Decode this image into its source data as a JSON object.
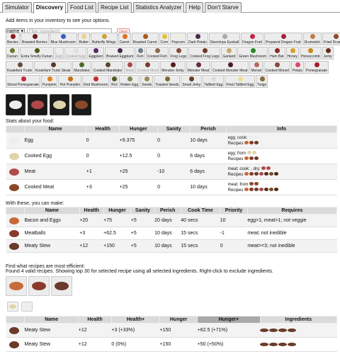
{
  "tabs": [
    "Simulator",
    "Discovery",
    "Food List",
    "Recipe List",
    "Statistics Analyzer",
    "Help",
    "Don't Starve"
  ],
  "active_tab": "Discovery",
  "intro": "Add items in your inventory to see your options.",
  "filter": {
    "select_value": "name ▾",
    "placeholder": "Filter ingredients",
    "clear_label": "clear"
  },
  "ingredient_rows": [
    [
      {
        "n": "Berries",
        "c": "#8b1a1a"
      },
      {
        "n": "Roasted Berries",
        "c": "#6b1a1a"
      },
      {
        "n": "Blue Mushroom",
        "c": "#3a5ec8"
      },
      {
        "n": "Butter",
        "c": "#e8d28a"
      },
      {
        "n": "Butterfly Wings",
        "c": "#c9a43a"
      },
      {
        "n": "Carrot",
        "c": "#e0701a"
      },
      {
        "n": "Roasted Carrot",
        "c": "#a85a20"
      },
      {
        "n": "Corn",
        "c": "#e4c23a"
      },
      {
        "n": "Popcorn",
        "c": "#eeeedd"
      },
      {
        "n": "Dark Petals",
        "c": "#4a2a4a"
      },
      {
        "n": "Deerclops Eyeball",
        "c": "#aaaaaa"
      },
      {
        "n": "Dragon Fruit",
        "c": "#c2264a"
      },
      {
        "n": "Prepared Dragon Fruit",
        "c": "#a81e3c"
      },
      {
        "n": "Drumstick",
        "c": "#c47a4a"
      },
      {
        "n": "Fried Drumstick",
        "c": "#8a4a24"
      }
    ],
    [
      {
        "n": "Durian",
        "c": "#6a7a2a"
      },
      {
        "n": "Extra Smelly Durian",
        "c": "#4a5a1a"
      },
      {
        "n": "Egg",
        "c": "#eeeeee",
        "dim": true
      },
      {
        "n": "Cooked Egg",
        "c": "#dddddd",
        "dim": true
      },
      {
        "n": "Eggplant",
        "c": "#5a2a6a"
      },
      {
        "n": "Braised Eggplant",
        "c": "#4a2a4a"
      },
      {
        "n": "Fish",
        "c": "#6a7a8a"
      },
      {
        "n": "Cooked Fish",
        "c": "#8a6a4a"
      },
      {
        "n": "Frog Legs",
        "c": "#8a4a3a"
      },
      {
        "n": "Cooked Frog Legs",
        "c": "#6a3a2a"
      },
      {
        "n": "Garland",
        "c": "#c8a86a"
      },
      {
        "n": "Green Mushroom",
        "c": "#2a8a2a"
      },
      {
        "n": "Ham Bat",
        "c": "#8a2a2a"
      },
      {
        "n": "Honey",
        "c": "#d8a020"
      },
      {
        "n": "Honeycomb",
        "c": "#c88a1a"
      },
      {
        "n": "Jerky",
        "c": "#6a2a1a"
      }
    ],
    [
      {
        "n": "Koalefant Trunk",
        "c": "#6a4a3a"
      },
      {
        "n": "Koalefant Trunk Steak",
        "c": "#5a3a2a"
      },
      {
        "n": "Mandrake",
        "c": "#4a6a2a"
      },
      {
        "n": "Cooked Mandrake",
        "c": "#5a4a2a"
      },
      {
        "n": "Meat",
        "c": "#a84a4a",
        "dim": true
      },
      {
        "n": "Cooked Meat",
        "c": "#7a3a2a",
        "dim": true
      },
      {
        "n": "Monster Jerky",
        "c": "#5a1a1a"
      },
      {
        "n": "Monster Meat",
        "c": "#6a2a3a"
      },
      {
        "n": "Cooked Monster Meat",
        "c": "#4a1a2a"
      },
      {
        "n": "Morsel",
        "c": "#b86a5a"
      },
      {
        "n": "Cooked Morsel",
        "c": "#8a4a3a"
      },
      {
        "n": "Petals",
        "c": "#d84a6a"
      },
      {
        "n": "Pomegranate",
        "c": "#a81a2a"
      }
    ],
    [
      {
        "n": "Sliced Pomegranate",
        "c": "#c82a3a"
      },
      {
        "n": "Pumpkin",
        "c": "#e0801a"
      },
      {
        "n": "Hot Pumpkin",
        "c": "#c86a1a"
      },
      {
        "n": "Red Mushroom",
        "c": "#c82a2a"
      },
      {
        "n": "Rot",
        "c": "#4a5a2a"
      },
      {
        "n": "Rotten Egg",
        "c": "#7a8a5a"
      },
      {
        "n": "Seeds",
        "c": "#9a8a5a"
      },
      {
        "n": "Toasted Seeds",
        "c": "#7a6a3a"
      },
      {
        "n": "Small Jerky",
        "c": "#6a3a2a"
      },
      {
        "n": "Tallbird Egg",
        "c": "#dddddd"
      },
      {
        "n": "Fried Tallbird Egg",
        "c": "#eedd99"
      },
      {
        "n": "Twigs",
        "c": "#8a6a3a"
      }
    ]
  ],
  "selected_ingredients": [
    {
      "name": "egg-icon",
      "color": "#eeeeee"
    },
    {
      "name": "meat-icon",
      "color": "#b04a4a"
    },
    {
      "name": "cooked-egg-icon",
      "color": "#ddd4aa"
    },
    {
      "name": "cooked-meat-icon",
      "color": "#8a4a2a"
    }
  ],
  "stats_title": "Stats about your food:",
  "stats_headers": [
    "",
    "Name",
    "Health",
    "Hunger",
    "Sanity",
    "Perish",
    "Info"
  ],
  "stats_rows": [
    {
      "icon": "#eeeeee",
      "name": "Egg",
      "health": "0",
      "hunger": "+9.375",
      "sanity": "0",
      "perish": "10 days",
      "info1": "egg; cook: ",
      "info2": "Recipes "
    },
    {
      "icon": "#ddd4aa",
      "name": "Cooked Egg",
      "health": "0",
      "hunger": "+12.5",
      "sanity": "0",
      "perish": "6 days",
      "info1": "egg; from ",
      "info2": "Recipes "
    },
    {
      "icon": "#b04a4a",
      "name": "Meat",
      "health": "+1",
      "hunger": "+25",
      "sanity": "-10",
      "perish": "6 days",
      "info1": "meat; cook: , dry: ",
      "info2": "Recipes "
    },
    {
      "icon": "#8a4a2a",
      "name": "Cooked Meat",
      "health": "+3",
      "hunger": "+25",
      "sanity": "0",
      "perish": "10 days",
      "info1": "meat; from ",
      "info2": "Recipes "
    }
  ],
  "can_make_title": "With these, you can make:",
  "make_headers": [
    "",
    "Name",
    "Health",
    "Hunger",
    "Sanity",
    "Perish",
    "Cook Time",
    "Priority",
    "Requires"
  ],
  "make_rows": [
    {
      "icon": "#c86a3a",
      "name": "Bacon and Eggs",
      "health": "+20",
      "hunger": "+75",
      "sanity": "+5",
      "perish": "20 days",
      "cook": "40 secs",
      "priority": "10",
      "requires": "egg>1; meat>1; not veggie"
    },
    {
      "icon": "#8a3a2a",
      "name": "Meatballs",
      "health": "+3",
      "hunger": "+62.5",
      "sanity": "+5",
      "perish": "10 days",
      "cook": "15 secs",
      "priority": "-1",
      "requires": "meat; not inedible"
    },
    {
      "icon": "#6a3a2a",
      "name": "Meaty Stew",
      "health": "+12",
      "hunger": "+150",
      "sanity": "+5",
      "perish": "10 days",
      "cook": "15 secs",
      "priority": "0",
      "requires": "meat>=3; not inedible"
    }
  ],
  "find_title": "Find what recipes are most efficient:",
  "find_note": "Found 4 valid recipes. Showing top 30 for selected recipe using all selected ingredients. Right-click to exclude ingredients.",
  "recipe_options": [
    {
      "name": "bacon-and-eggs-icon",
      "color": "#c86a3a"
    },
    {
      "name": "meatballs-icon",
      "color": "#8a3a2a"
    },
    {
      "name": "meaty-stew-icon",
      "color": "#6a3a2a"
    }
  ],
  "small_options": [
    {
      "name": "cooked-egg-small-icon",
      "color": "#ddd4aa"
    },
    {
      "name": "egg-small-icon",
      "color": "#eeeeee"
    }
  ],
  "eff_headers": [
    "",
    "Name",
    "Health",
    "Health+",
    "Hunger",
    "Hunger+",
    "Ingredients"
  ],
  "eff_sorted": "Hunger+",
  "eff_rows": [
    {
      "icon": "#6a3a2a",
      "name": "Meaty Stew",
      "health": "+12",
      "healthp": "+3 (+33%)",
      "hunger": "+150",
      "hungerp": "+62.5 (+71%)"
    },
    {
      "icon": "#6a3a2a",
      "name": "Meaty Stew",
      "health": "+12",
      "healthp": "0 (0%)",
      "hunger": "+150",
      "hungerp": "+50 (+50%)"
    }
  ],
  "colors": {
    "header_bg": "#dadada",
    "row_alt": "#f3f3f3",
    "sorted_header": "#a9a9a9"
  }
}
